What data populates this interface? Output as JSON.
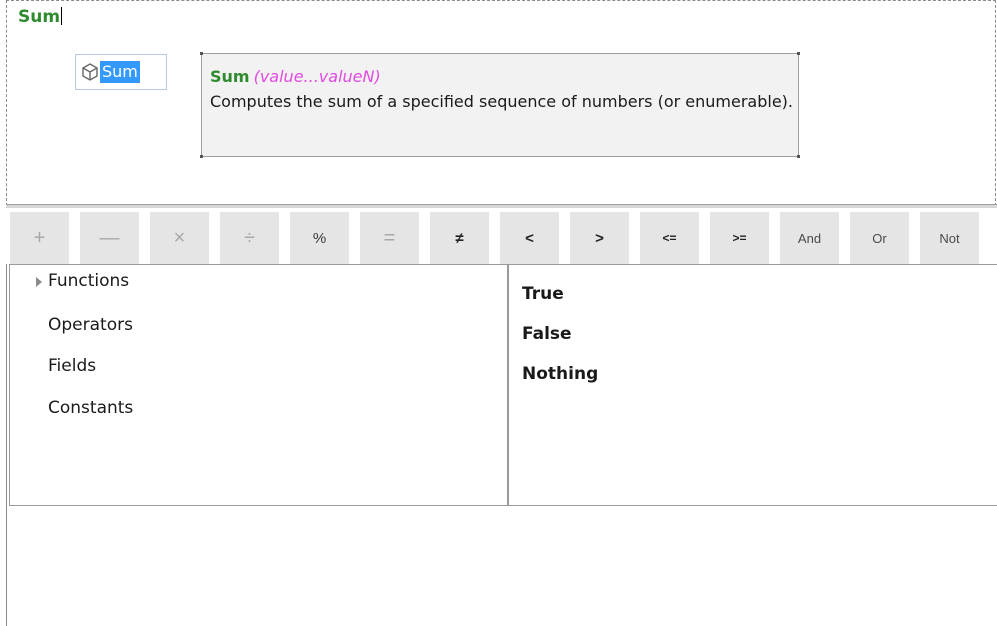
{
  "editor": {
    "expression_text": "Sum"
  },
  "autocomplete": {
    "items": [
      {
        "label": "Sum",
        "icon": "cube-icon",
        "selected": true
      }
    ]
  },
  "tooltip": {
    "function_name": "Sum",
    "signature": "(value...valueN)",
    "description": "Computes the sum of a specified  sequence of numbers (or enumerable)."
  },
  "toolbar": {
    "buttons": [
      {
        "label": "+",
        "name": "plus"
      },
      {
        "label": "—",
        "name": "minus"
      },
      {
        "label": "×",
        "name": "multiply"
      },
      {
        "label": "÷",
        "name": "divide"
      },
      {
        "label": "%",
        "name": "modulo"
      },
      {
        "label": "=",
        "name": "equals"
      },
      {
        "label": "≠",
        "name": "not-equals"
      },
      {
        "label": "<",
        "name": "less-than"
      },
      {
        "label": ">",
        "name": "greater-than"
      },
      {
        "label": "<=",
        "name": "less-or-equal"
      },
      {
        "label": ">=",
        "name": "greater-or-equal"
      },
      {
        "label": "And",
        "name": "and"
      },
      {
        "label": "Or",
        "name": "or"
      },
      {
        "label": "Not",
        "name": "not"
      }
    ]
  },
  "categories": {
    "items": [
      {
        "label": "Functions",
        "expandable": true
      },
      {
        "label": "Operators"
      },
      {
        "label": "Fields"
      },
      {
        "label": "Constants"
      }
    ]
  },
  "values": {
    "items": [
      {
        "label": "True"
      },
      {
        "label": "False"
      },
      {
        "label": "Nothing"
      }
    ]
  },
  "colors": {
    "function_green": "#2e8b2e",
    "signature_magenta": "#e14be1",
    "selection_blue": "#3399ff",
    "button_gray": "#e5e5e5"
  }
}
